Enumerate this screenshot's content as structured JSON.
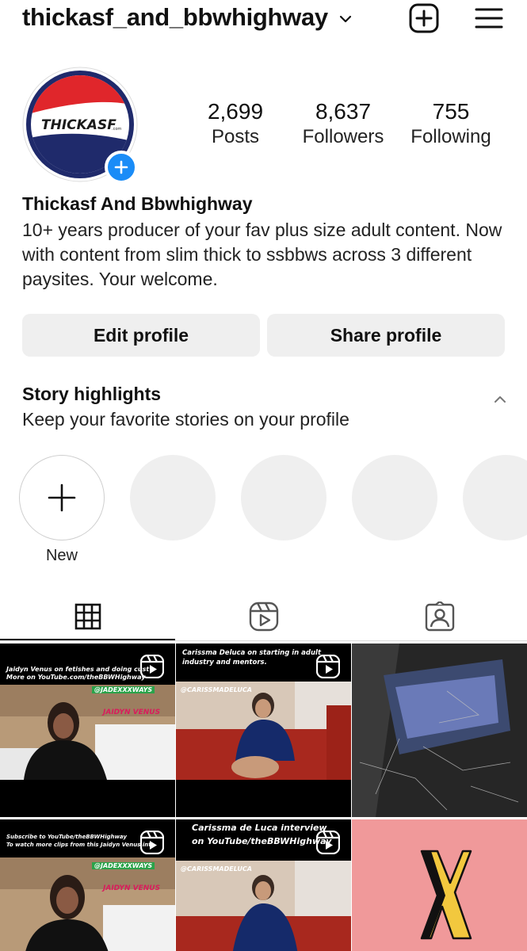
{
  "header": {
    "username": "thickasf_and_bbwhighway"
  },
  "profile": {
    "avatar_brand_text": "THICKASF",
    "avatar_brand_suffix": ".com",
    "stats": [
      {
        "value": "2,699",
        "label": "Posts"
      },
      {
        "value": "8,637",
        "label": "Followers"
      },
      {
        "value": "755",
        "label": "Following"
      }
    ],
    "full_name": "Thickasf And Bbwhighway",
    "bio": "10+ years producer of your fav plus size adult content. Now with content from slim thick to ssbbws across 3 different paysites. Your welcome."
  },
  "actions": {
    "edit_label": "Edit profile",
    "share_label": "Share profile"
  },
  "highlights": {
    "title": "Story highlights",
    "subtitle": "Keep your favorite stories on your profile",
    "new_label": "New"
  },
  "posts": [
    {
      "caption": "Jaidyn Venus on fetishes and doing cust",
      "caption2": "More on YouTube.com/theBBWHighway",
      "handle": "@JADEXXXWAYS",
      "name_tag": "JAIDYN VENUS"
    },
    {
      "caption": "Carissma Deluca on starting in adult industry and mentors.",
      "handle": "@CARISSMADELUCA"
    },
    {
      "caption": ""
    },
    {
      "caption": "Subscribe to YouTube/theBBWHighway",
      "caption2": "To watch more clips from this Jaidyn Venus int",
      "handle": "@JADEXXXWAYS",
      "name_tag": "JAIDYN VENUS"
    },
    {
      "caption": "Carissma de Luca interview on YouTube/theBBWHighway",
      "handle": "@CARISSMADELUCA"
    },
    {
      "caption": ""
    }
  ],
  "colors": {
    "accent": "#1a8cf7",
    "button_bg": "#efefef",
    "tile_pink": "#f0999a"
  }
}
